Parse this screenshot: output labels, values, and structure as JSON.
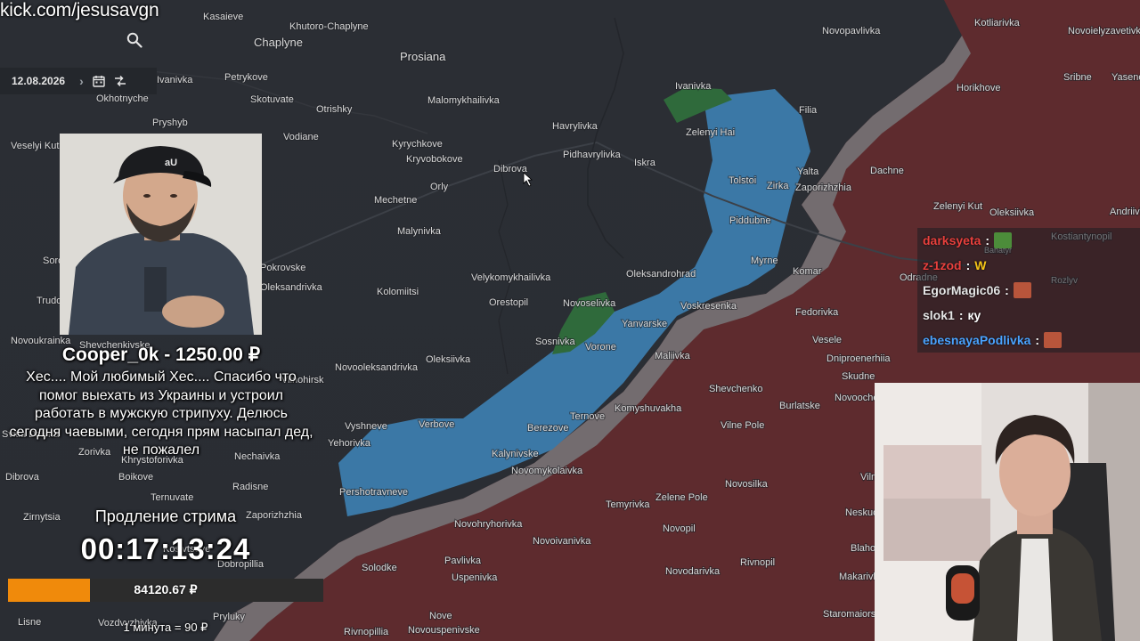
{
  "stream": {
    "url": "kick.com/jesusavgn"
  },
  "toolbar": {
    "date": "12.08.2026"
  },
  "map_labels": [
    {
      "name": "Kasaieve"
    },
    {
      "name": "Khutoro-Chaplyne"
    },
    {
      "name": "Chaplyne"
    },
    {
      "name": "Prosiana"
    },
    {
      "name": "Novopavlivka"
    },
    {
      "name": "Kotliarivka"
    },
    {
      "name": "Novoielyzavetivka"
    },
    {
      "name": "Petrykove"
    },
    {
      "name": "Skotuvate"
    },
    {
      "name": "Malomykhailivka"
    },
    {
      "name": "Ivanivka"
    },
    {
      "name": "Horikhove"
    },
    {
      "name": "Sribne"
    },
    {
      "name": "Yasenov"
    },
    {
      "name": "Okhotnyche"
    },
    {
      "name": "Otrishky"
    },
    {
      "name": "Filia"
    },
    {
      "name": "Pryshyb"
    },
    {
      "name": "Havrylivka"
    },
    {
      "name": "Zelenyi Hai"
    },
    {
      "name": "Vodiane"
    },
    {
      "name": "Kyrychkove"
    },
    {
      "name": "Kryvobokove"
    },
    {
      "name": "Pidhavrylivka"
    },
    {
      "name": "Iskra"
    },
    {
      "name": "Dibrova"
    },
    {
      "name": "Yalta"
    },
    {
      "name": "Dachne"
    },
    {
      "name": "Tolstoi"
    },
    {
      "name": "Zirka"
    },
    {
      "name": "Zaporizhzhia"
    },
    {
      "name": "Orly"
    },
    {
      "name": "Mechetne"
    },
    {
      "name": "Zelenyi Kut"
    },
    {
      "name": "Oleksiivka"
    },
    {
      "name": "Andriivk"
    },
    {
      "name": "Malynivka"
    },
    {
      "name": "Piddubne"
    },
    {
      "name": "Kostiantynopil"
    },
    {
      "name": "Pokrovske"
    },
    {
      "name": "Myrne"
    },
    {
      "name": "Bahatyr"
    },
    {
      "name": "Komar"
    },
    {
      "name": "Odradne"
    },
    {
      "name": "Rozlyv"
    },
    {
      "name": "Velykomykhailivka"
    },
    {
      "name": "Oleksandrohrad"
    },
    {
      "name": "Oleksandrivka"
    },
    {
      "name": "Kolomiitsi"
    },
    {
      "name": "Orestopil"
    },
    {
      "name": "Novoselivka"
    },
    {
      "name": "Voskresenka"
    },
    {
      "name": "Fedorivka"
    },
    {
      "name": "Yanvarske"
    },
    {
      "name": "Sosnivka"
    },
    {
      "name": "Vorone"
    },
    {
      "name": "Vesele"
    },
    {
      "name": "Maliivka"
    },
    {
      "name": "Dniproenerhiia"
    },
    {
      "name": "Novooleksandrivka"
    },
    {
      "name": "Oleksiivka"
    },
    {
      "name": "Vilnohirsk"
    },
    {
      "name": "Skudne"
    },
    {
      "name": "Shevchenko"
    },
    {
      "name": "Ternove"
    },
    {
      "name": "Komyshuvakha"
    },
    {
      "name": "Burlatske"
    },
    {
      "name": "Vyshneve"
    },
    {
      "name": "Verbove"
    },
    {
      "name": "Berezove"
    },
    {
      "name": "Vilne Pole"
    },
    {
      "name": "Yehorivka"
    },
    {
      "name": "Nechaivka"
    },
    {
      "name": "Kalynivske"
    },
    {
      "name": "Novomykolaivka"
    },
    {
      "name": "Khrystoforivka"
    },
    {
      "name": "Boikove"
    },
    {
      "name": "Radisne"
    },
    {
      "name": "Pershotravneve"
    },
    {
      "name": "Zelene Pole"
    },
    {
      "name": "Novosilka"
    },
    {
      "name": "Ternuvate"
    },
    {
      "name": "Temyrivka"
    },
    {
      "name": "Zirnytsia"
    },
    {
      "name": "Novohryhorivka"
    },
    {
      "name": "Novoivanivka"
    },
    {
      "name": "Novopil"
    },
    {
      "name": "Kosivtseve"
    },
    {
      "name": "Dobropillia"
    },
    {
      "name": "Solodke"
    },
    {
      "name": "Pavlivka"
    },
    {
      "name": "Rivnopil"
    },
    {
      "name": "Uspenivka"
    },
    {
      "name": "Novodarivka"
    },
    {
      "name": "Lisne"
    },
    {
      "name": "Nove"
    },
    {
      "name": "Staromaiorsk"
    },
    {
      "name": "Vozdvyzhivka"
    },
    {
      "name": "Pryluky"
    },
    {
      "name": "Rivnopillia"
    },
    {
      "name": "Novouspenivske"
    },
    {
      "name": "Sorokyne"
    },
    {
      "name": "Trudove"
    },
    {
      "name": "Novoukrainka"
    },
    {
      "name": "Shevchenkivske"
    },
    {
      "name": "Svitla Dolyna"
    },
    {
      "name": "Zorivka"
    },
    {
      "name": "Dibrova"
    },
    {
      "name": "Veselyi Kut"
    },
    {
      "name": "Ivanivka"
    },
    {
      "name": "Vilne"
    },
    {
      "name": "Neskuchne"
    },
    {
      "name": "Blahodatne"
    },
    {
      "name": "Makarivka"
    },
    {
      "name": "Novoocheretuvate"
    },
    {
      "name": "Zaporizhzhia"
    },
    {
      "name": "Prosiana"
    }
  ],
  "donation": {
    "name_line": "Cooper_0k - 1250.00 ₽",
    "message": "Хес.... Мой любимый Хес.... Спасибо что помог выехать из Украины и устроил работать в мужскую стрипуху. Делюсь сегодня чаевыми, сегодня прям насыпал дед, не пожалел"
  },
  "subathon": {
    "label": "Продление стрима",
    "timer": "00:17:13:24",
    "amount": "84120.67 ₽",
    "progress_fraction": 0.26,
    "rate": "1 минута = 90 ₽"
  },
  "chat": {
    "messages": [
      {
        "user": "darksyeta",
        "color": "#e8403d",
        "text": "",
        "emote": "pepe-emote",
        "emote_color": "#4c8c3a"
      },
      {
        "user": "z-1zod",
        "color": "#e8403d",
        "text": "W",
        "emote": "",
        "emote_color": ""
      },
      {
        "user": "EgorMagic06",
        "color": "#e6e6e6",
        "text": "",
        "emote": "face-emote",
        "emote_color": "#b8553b"
      },
      {
        "user": "slok1",
        "color": "#e6e6e6",
        "text": "ку",
        "emote": "",
        "emote_color": ""
      },
      {
        "user": "ebesnayaPodlivka",
        "color": "#4aa3ff",
        "text": "",
        "emote": "face-emote",
        "emote_color": "#b8553b"
      }
    ]
  },
  "colors": {
    "russian_held": "#5e2b2e",
    "ukrainian_held": "#2a3a4a",
    "liberated": "#3d7ba8",
    "grey_zone": "#7b7c7d",
    "accent": "#f08a0b"
  }
}
